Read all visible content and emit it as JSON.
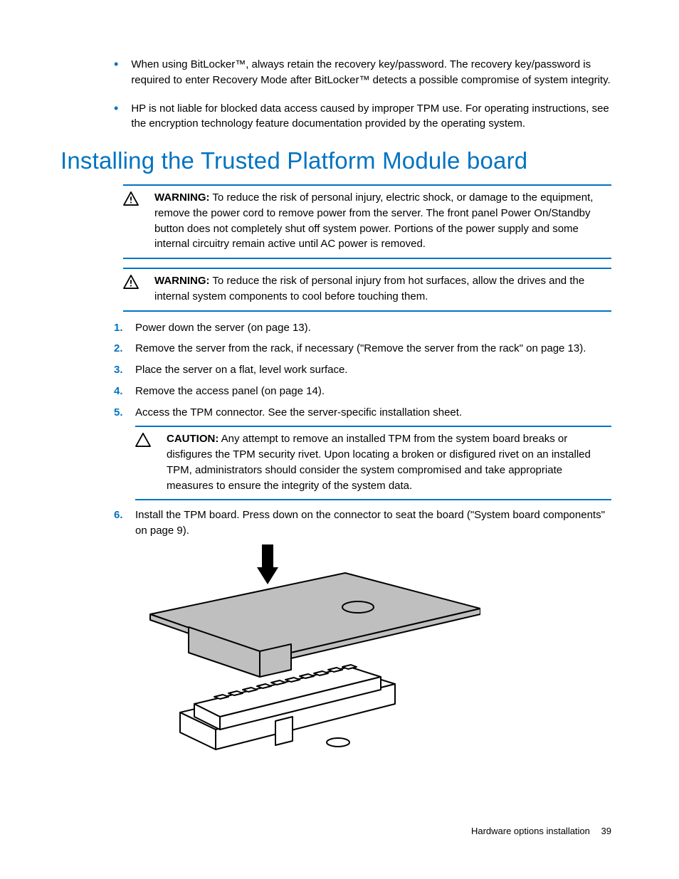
{
  "intro_bullets": [
    "When using BitLocker™, always retain the recovery key/password. The recovery key/password is required to enter Recovery Mode after BitLocker™ detects a possible compromise of system integrity.",
    "HP is not liable for blocked data access caused by improper TPM use. For operating instructions, see the encryption technology feature documentation provided by the operating system."
  ],
  "heading": "Installing the Trusted Platform Module board",
  "warnings": [
    {
      "label": "WARNING:",
      "text": "To reduce the risk of personal injury, electric shock, or damage to the equipment, remove the power cord to remove power from the server. The front panel Power On/Standby button does not completely shut off system power. Portions of the power supply and some internal circuitry remain active until AC power is removed."
    },
    {
      "label": "WARNING:",
      "text": "To reduce the risk of personal injury from hot surfaces, allow the drives and the internal system components to cool before touching them."
    }
  ],
  "steps": [
    {
      "num": "1.",
      "text": "Power down the server (on page 13)."
    },
    {
      "num": "2.",
      "text": "Remove the server from the rack, if necessary (\"Remove the server from the rack\" on page 13)."
    },
    {
      "num": "3.",
      "text": "Place the server on a flat, level work surface."
    },
    {
      "num": "4.",
      "text": "Remove the access panel (on page 14)."
    },
    {
      "num": "5.",
      "text": "Access the TPM connector. See the server-specific installation sheet."
    }
  ],
  "caution": {
    "label": "CAUTION:",
    "text": "Any attempt to remove an installed TPM from the system board breaks or disfigures the TPM security rivet. Upon locating a broken or disfigured rivet on an installed TPM, administrators should consider the system compromised and take appropriate measures to ensure the integrity of the system data."
  },
  "step6": {
    "num": "6.",
    "text": "Install the TPM board. Press down on the connector to seat the board (\"System board components\" on page 9)."
  },
  "footer": {
    "label": "Hardware options installation",
    "page": "39"
  }
}
